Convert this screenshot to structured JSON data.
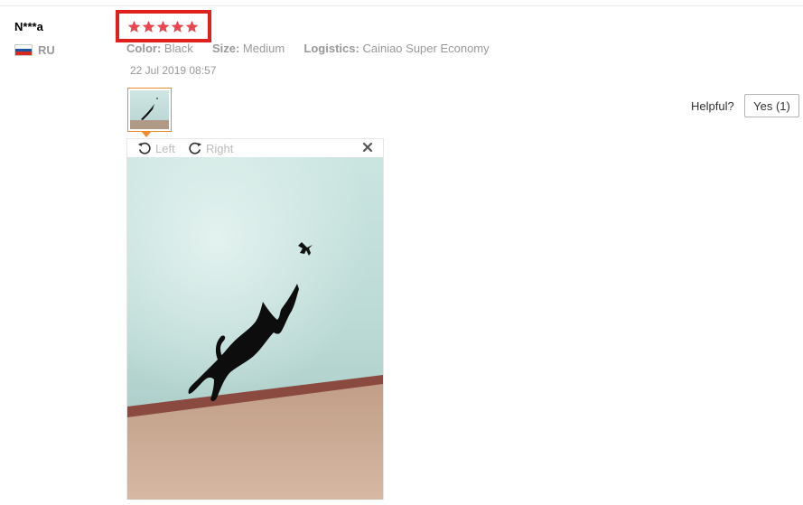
{
  "review": {
    "user_name": "N***a",
    "country_code": "RU",
    "rating": 5,
    "attributes": [
      {
        "key": "Color:",
        "value": "Black"
      },
      {
        "key": "Size:",
        "value": "Medium"
      },
      {
        "key": "Logistics:",
        "value": "Cainiao Super Economy"
      }
    ],
    "date": "22 Jul 2019 08:57",
    "helpful_label": "Helpful?",
    "yes_button": "Yes (1)"
  },
  "viewer": {
    "rotate_left": "Left",
    "rotate_right": "Right",
    "close_icon": "close-icon"
  },
  "colors": {
    "star": "#e7464c",
    "highlight_border": "#e0201b",
    "thumb_border": "#f08a2c"
  }
}
